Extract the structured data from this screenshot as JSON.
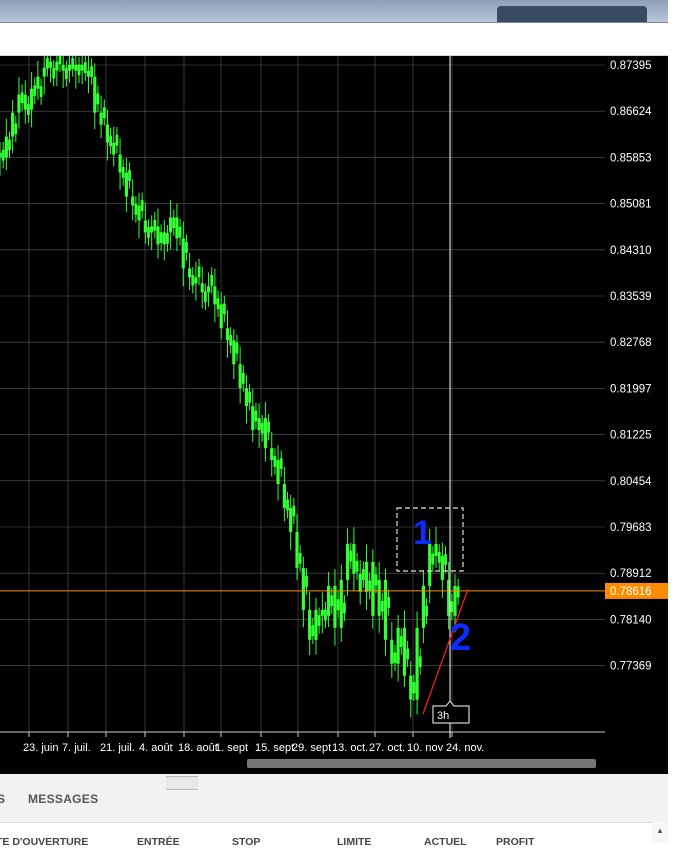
{
  "window": {
    "title_bar_color": "#9aaac0"
  },
  "chart": {
    "background": "#000000",
    "candle_color": "#33ff33",
    "price_line_color": "#ff8c00",
    "current_price": "0.78616",
    "y_axis_labels": [
      "0.87395",
      "0.86624",
      "0.85853",
      "0.85081",
      "0.84310",
      "0.83539",
      "0.82768",
      "0.81997",
      "0.81225",
      "0.80454",
      "0.79683",
      "0.78912",
      "0.78140",
      "0.77369"
    ],
    "x_axis_labels": [
      "in",
      "23. juin",
      "7. juil.",
      "21. juil.",
      "4. août",
      "18. août",
      "1. sept",
      "15. sept",
      "29. sept",
      "13. oct.",
      "27. oct.",
      "10. nov",
      "24. nov."
    ],
    "timeframe_badge": "3h",
    "annotations": [
      "1",
      "2"
    ]
  },
  "chart_data": {
    "type": "candlestick",
    "series": [
      {
        "name": "",
        "values": [
          0.8585,
          0.862,
          0.866,
          0.869,
          0.8665,
          0.87,
          0.872,
          0.8735,
          0.8745,
          0.873,
          0.874,
          0.873,
          0.874,
          0.873,
          0.872,
          0.866,
          0.864,
          0.861,
          0.859,
          0.856,
          0.852,
          0.8505,
          0.848,
          0.846,
          0.847,
          0.844,
          0.846,
          0.8485,
          0.845,
          0.84,
          0.8385,
          0.8375,
          0.836,
          0.837,
          0.834,
          0.83,
          0.828,
          0.824,
          0.82,
          0.817,
          0.813,
          0.815,
          0.81,
          0.808,
          0.804,
          0.8,
          0.796,
          0.79,
          0.783,
          0.778,
          0.783,
          0.782,
          0.787,
          0.78,
          0.788,
          0.794,
          0.789,
          0.786,
          0.791,
          0.782,
          0.788,
          0.778,
          0.774,
          0.78,
          0.772,
          0.768,
          0.78,
          0.787,
          0.794,
          0.792,
          0.788,
          0.782,
          0.787
        ]
      }
    ],
    "ylim": [
      0.766,
      0.8745
    ],
    "x_categories": [
      "in",
      "23. juin",
      "7. juil.",
      "21. juil.",
      "4. août",
      "18. août",
      "1. sept",
      "15. sept",
      "29. sept",
      "13. oct.",
      "27. oct.",
      "10. nov",
      "24. nov."
    ]
  },
  "panel": {
    "tabs": [
      "S",
      "MESSAGES"
    ],
    "columns": [
      "TE D'OUVERTURE",
      "ENTRÉE",
      "STOP",
      "LIMITE",
      "ACTUEL",
      "PROFIT"
    ]
  }
}
